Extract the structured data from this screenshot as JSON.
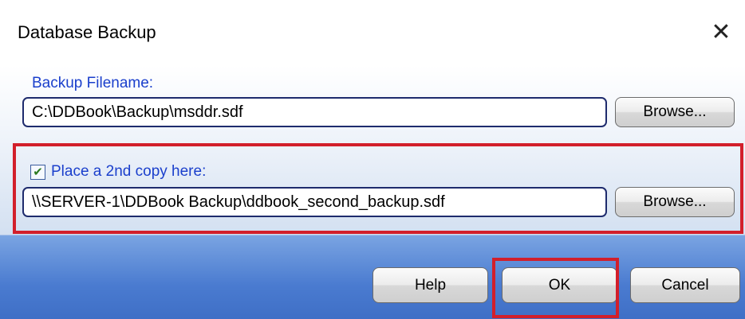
{
  "window": {
    "title": "Database Backup",
    "close_glyph": "✕"
  },
  "backup": {
    "label": "Backup Filename:",
    "filename": "C:\\DDBook\\Backup\\msddr.sdf",
    "browse_label": "Browse..."
  },
  "second_copy": {
    "checked": true,
    "check_glyph": "✔",
    "label": "Place a 2nd copy here:",
    "path": "\\\\SERVER-1\\DDBook Backup\\ddbook_second_backup.sdf",
    "browse_label": "Browse..."
  },
  "footer": {
    "help_label": "Help",
    "ok_label": "OK",
    "cancel_label": "Cancel"
  },
  "colors": {
    "label_blue": "#1a3fcc",
    "highlight_red": "#d21f2b",
    "footer_blue": "#4a7bd0"
  }
}
